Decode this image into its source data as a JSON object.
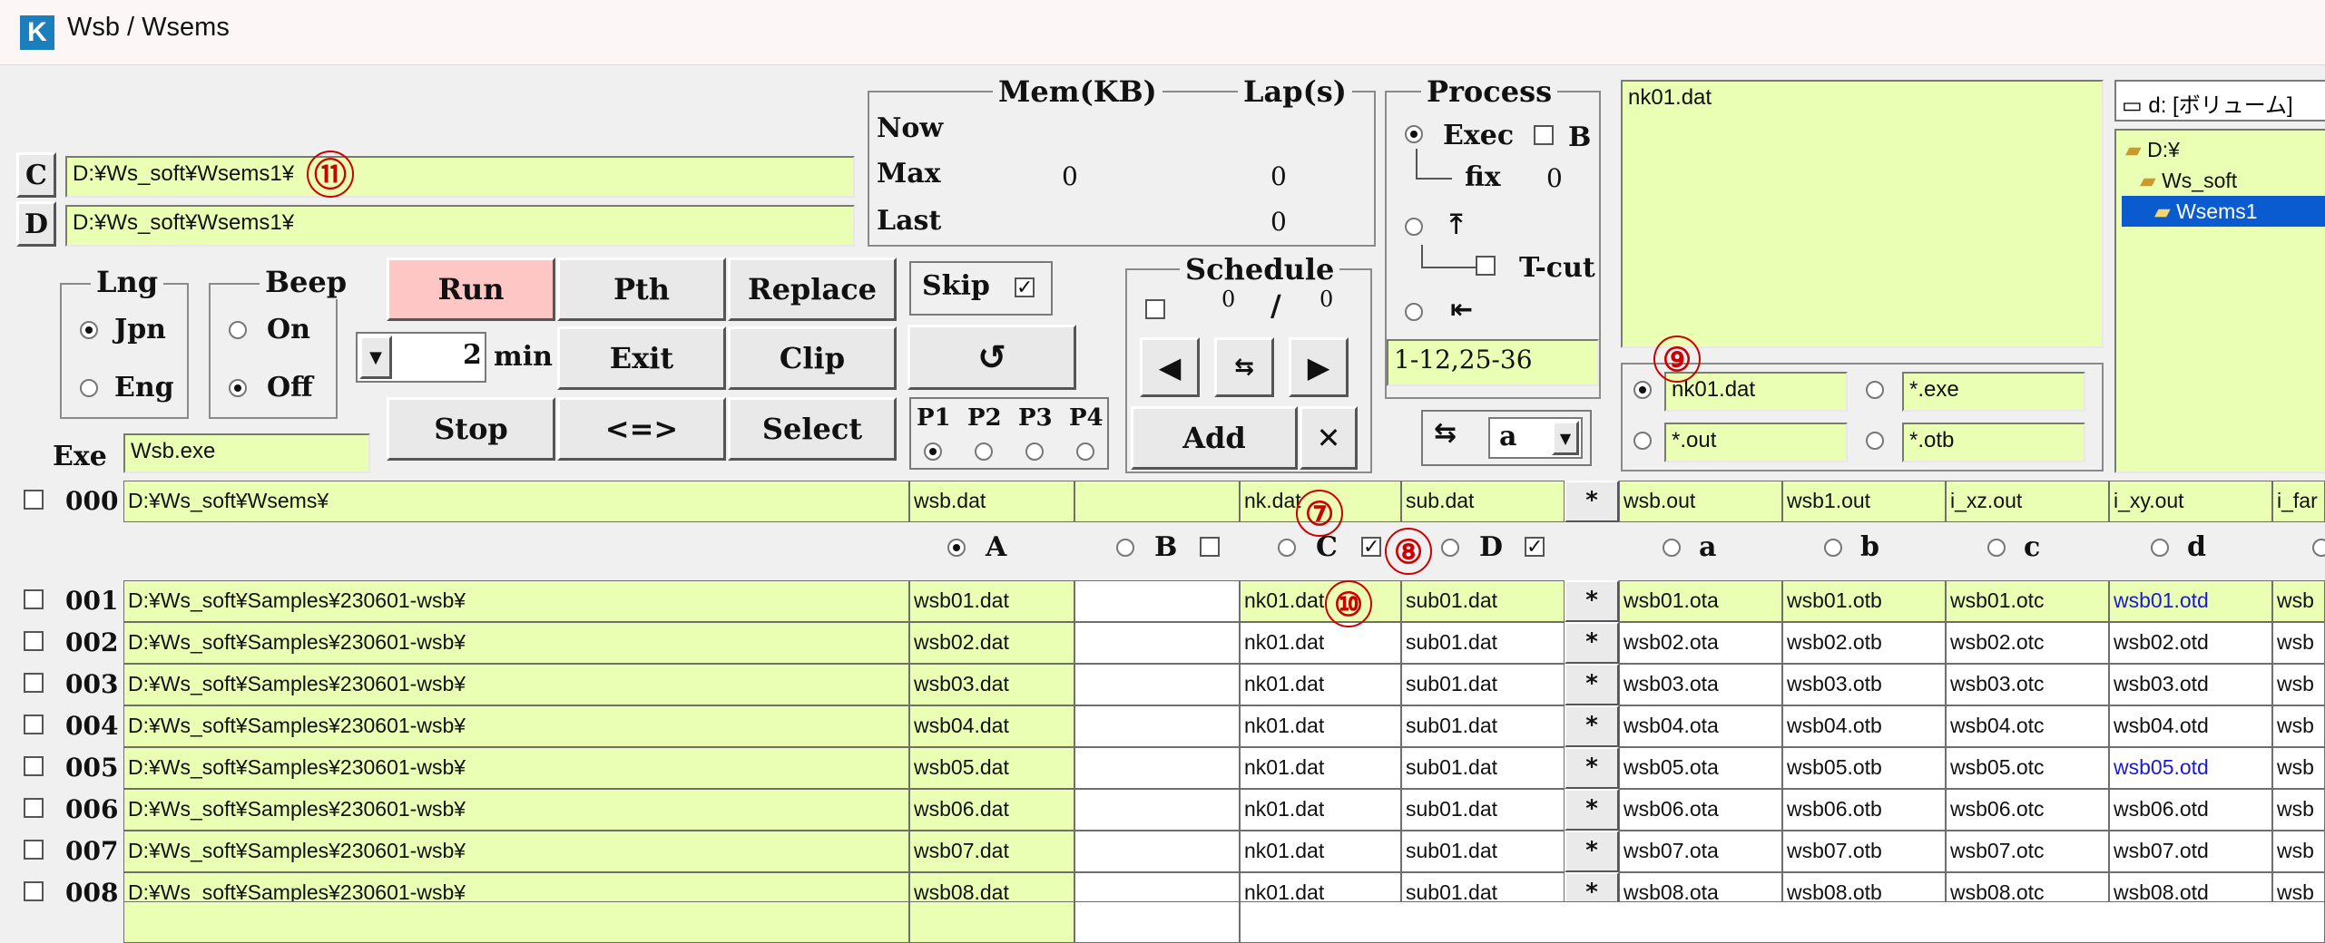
{
  "window": {
    "title": "Wsb / Wsems",
    "logo": "K"
  },
  "paths": {
    "c_label": "C",
    "c_value": "D:¥Ws_soft¥Wsems1¥",
    "d_label": "D",
    "d_value": "D:¥Ws_soft¥Wsems1¥"
  },
  "mem": {
    "title": "Mem(KB)",
    "lap_title": "Lap(s)",
    "now_label": "Now",
    "max_label": "Max",
    "last_label": "Last",
    "max_mem": "0",
    "max_lap": "0",
    "last_lap": "0"
  },
  "process": {
    "title": "Process",
    "exec_label": "Exec",
    "b_label": "B",
    "fix_label": "fix",
    "fix_value": "0",
    "tcut_label": "T-cut",
    "range_value": "1-12,25-36"
  },
  "preview": {
    "text": "nk01.dat"
  },
  "drive": {
    "selector": "d: [ボリューム]",
    "tree": [
      "D:¥",
      "Ws_soft",
      "Wsems1"
    ]
  },
  "lng": {
    "title": "Lng",
    "jpn": "Jpn",
    "eng": "Eng"
  },
  "beep": {
    "title": "Beep",
    "on": "On",
    "off": "Off"
  },
  "buttons": {
    "run": "Run",
    "pth": "Pth",
    "replace": "Replace",
    "exit": "Exit",
    "clip": "Clip",
    "stop": "Stop",
    "swap": "<=>",
    "select": "Select",
    "skip": "Skip",
    "reload": "↺",
    "add": "Add",
    "del": "✕"
  },
  "min": {
    "value": "2",
    "unit": "min"
  },
  "priority": {
    "p1": "P1",
    "p2": "P2",
    "p3": "P3",
    "p4": "P4"
  },
  "schedule": {
    "title": "Schedule",
    "count_a": "0",
    "slash": "/",
    "count_b": "0"
  },
  "exe": {
    "label": "Exe",
    "value": "Wsb.exe"
  },
  "filters": {
    "f1": "nk01.dat",
    "f2": "*.exe",
    "f3": "*.out",
    "f4": "*.otb"
  },
  "cycle": {
    "value": "a"
  },
  "header_row": {
    "num": "000",
    "path": "D:¥Ws_soft¥Wsems¥",
    "c1": "wsb.dat",
    "c2": "",
    "c3": "nk.dat",
    "c4": "sub.dat",
    "o1": "wsb.out",
    "o2": "wsb1.out",
    "o3": "i_xz.out",
    "o4": "i_xy.out",
    "o5": "i_far"
  },
  "col_labels": {
    "A": "A",
    "B": "B",
    "C": "C",
    "D": "D",
    "a": "a",
    "b": "b",
    "c": "c",
    "d": "d"
  },
  "annotations": {
    "n7": "⑦",
    "n8": "⑧",
    "n9": "⑨",
    "n10": "⑩",
    "n11": "⑪"
  },
  "rows": [
    {
      "num": "001",
      "path": "D:¥Ws_soft¥Samples¥230601-wsb¥",
      "c1": "wsb01.dat",
      "c3": "nk01.dat",
      "c4": "sub01.dat",
      "o1": "wsb01.ota",
      "o2": "wsb01.otb",
      "o3": "wsb01.otc",
      "o4": "wsb01.otd",
      "o5": "wsb"
    },
    {
      "num": "002",
      "path": "D:¥Ws_soft¥Samples¥230601-wsb¥",
      "c1": "wsb02.dat",
      "c3": "nk01.dat",
      "c4": "sub01.dat",
      "o1": "wsb02.ota",
      "o2": "wsb02.otb",
      "o3": "wsb02.otc",
      "o4": "wsb02.otd",
      "o5": "wsb"
    },
    {
      "num": "003",
      "path": "D:¥Ws_soft¥Samples¥230601-wsb¥",
      "c1": "wsb03.dat",
      "c3": "nk01.dat",
      "c4": "sub01.dat",
      "o1": "wsb03.ota",
      "o2": "wsb03.otb",
      "o3": "wsb03.otc",
      "o4": "wsb03.otd",
      "o5": "wsb"
    },
    {
      "num": "004",
      "path": "D:¥Ws_soft¥Samples¥230601-wsb¥",
      "c1": "wsb04.dat",
      "c3": "nk01.dat",
      "c4": "sub01.dat",
      "o1": "wsb04.ota",
      "o2": "wsb04.otb",
      "o3": "wsb04.otc",
      "o4": "wsb04.otd",
      "o5": "wsb"
    },
    {
      "num": "005",
      "path": "D:¥Ws_soft¥Samples¥230601-wsb¥",
      "c1": "wsb05.dat",
      "c3": "nk01.dat",
      "c4": "sub01.dat",
      "o1": "wsb05.ota",
      "o2": "wsb05.otb",
      "o3": "wsb05.otc",
      "o4": "wsb05.otd",
      "o5": "wsb"
    },
    {
      "num": "006",
      "path": "D:¥Ws_soft¥Samples¥230601-wsb¥",
      "c1": "wsb06.dat",
      "c3": "nk01.dat",
      "c4": "sub01.dat",
      "o1": "wsb06.ota",
      "o2": "wsb06.otb",
      "o3": "wsb06.otc",
      "o4": "wsb06.otd",
      "o5": "wsb"
    },
    {
      "num": "007",
      "path": "D:¥Ws_soft¥Samples¥230601-wsb¥",
      "c1": "wsb07.dat",
      "c3": "nk01.dat",
      "c4": "sub01.dat",
      "o1": "wsb07.ota",
      "o2": "wsb07.otb",
      "o3": "wsb07.otc",
      "o4": "wsb07.otd",
      "o5": "wsb"
    },
    {
      "num": "008",
      "path": "D:¥Ws_soft¥Samples¥230601-wsb¥",
      "c1": "wsb08.dat",
      "c3": "nk01.dat",
      "c4": "sub01.dat",
      "o1": "wsb08.ota",
      "o2": "wsb08.otb",
      "o3": "wsb08.otc",
      "o4": "wsb08.otd",
      "o5": "wsb"
    }
  ],
  "colors": {
    "field": "#eaffb4",
    "run": "#ffc6c6",
    "selected": "#0a5ad0",
    "annotation": "#cc0000",
    "link": "#1a1ad0"
  }
}
